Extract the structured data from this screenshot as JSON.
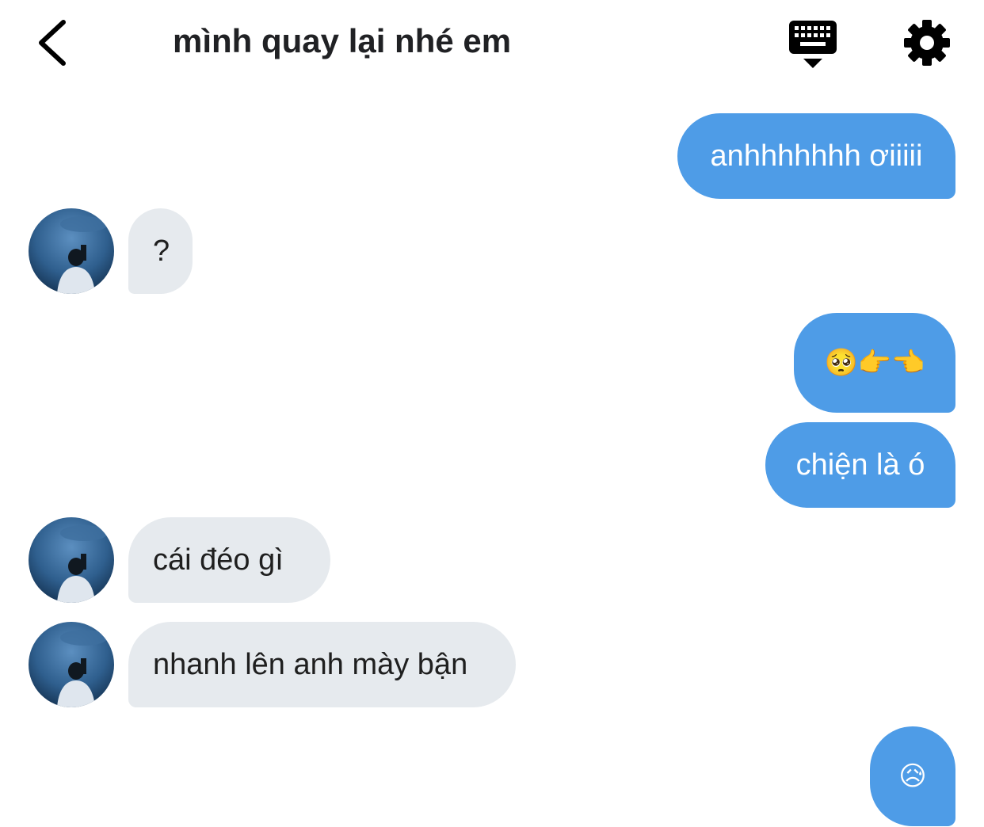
{
  "header": {
    "title": "mình quay lại nhé em",
    "back_icon": "chevron-left-icon",
    "keyboard_icon": "keyboard-hide-icon",
    "settings_icon": "gear-icon"
  },
  "colors": {
    "outgoing_bubble": "#4e9ce7",
    "incoming_bubble": "#e6eaee",
    "text_dark": "#202124",
    "text_light": "#ffffff"
  },
  "messages": [
    {
      "sender": "me",
      "text": "anhhhhhhh ơiiiii"
    },
    {
      "sender": "other",
      "text": "?",
      "avatar": true
    },
    {
      "sender": "me",
      "text": "🥺👉👈"
    },
    {
      "sender": "me",
      "text": "chiện là ó"
    },
    {
      "sender": "other",
      "text": "cái đéo gì",
      "avatar": true
    },
    {
      "sender": "other",
      "text": "nhanh lên anh mày bận",
      "avatar": true
    },
    {
      "sender": "me",
      "text": "😥"
    }
  ]
}
